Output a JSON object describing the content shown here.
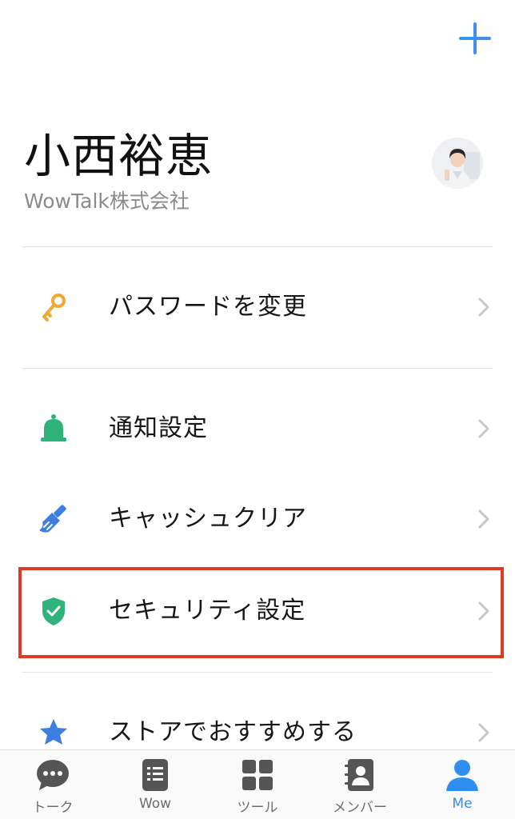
{
  "profile": {
    "name": "小西裕恵",
    "company": "WowTalk株式会社"
  },
  "menu": [
    {
      "label": "パスワードを変更",
      "icon": "key-icon",
      "icon_color": "#f0a830"
    },
    {
      "label": "通知設定",
      "icon": "bell-icon",
      "icon_color": "#2fb37a"
    },
    {
      "label": "キャッシュクリア",
      "icon": "brush-icon",
      "icon_color": "#3d7fe0"
    },
    {
      "label": "セキュリティ設定",
      "icon": "shield-check-icon",
      "icon_color": "#2fb37a",
      "highlighted": true
    },
    {
      "label": "ストアでおすすめする",
      "icon": "star-icon",
      "icon_color": "#3d7fe0"
    }
  ],
  "tabs": [
    {
      "label": "トーク",
      "icon": "chat-bubble-icon"
    },
    {
      "label": "Wow",
      "icon": "list-icon"
    },
    {
      "label": "ツール",
      "icon": "grid-icon"
    },
    {
      "label": "メンバー",
      "icon": "contacts-icon"
    },
    {
      "label": "Me",
      "icon": "person-icon",
      "active": true
    }
  ],
  "colors": {
    "accent": "#2f8ff0",
    "highlight_border": "#e13a22",
    "tab_icon": "#555555"
  }
}
